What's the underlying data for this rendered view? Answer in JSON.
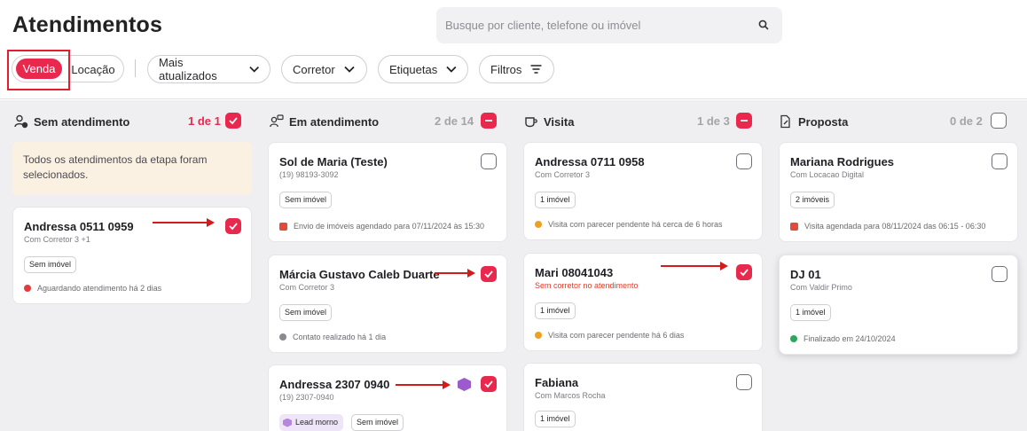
{
  "page_title": "Atendimentos",
  "search": {
    "placeholder": "Busque por cliente, telefone ou imóvel"
  },
  "segment": {
    "venda": "Venda",
    "locacao": "Locação"
  },
  "filters": {
    "sort": "Mais atualizados",
    "agent": "Corretor",
    "tags": "Etiquetas",
    "filters": "Filtros"
  },
  "columns": [
    {
      "title": "Sem atendimento",
      "count": "1 de 1",
      "notice": "Todos os atendimentos da etapa foram selecionados.",
      "cards": [
        {
          "name": "Andressa 0511 0959",
          "sub": "Com Corretor 3 +1",
          "tag": "Sem imóvel",
          "status": "Aguardando atendimento há 2 dias"
        }
      ]
    },
    {
      "title": "Em atendimento",
      "count": "2 de 14",
      "cards": [
        {
          "name": "Sol de Maria (Teste)",
          "sub": "(19) 98193-3092",
          "tag": "Sem imóvel",
          "status": "Envio de imóveis agendado para 07/11/2024 às 15:30"
        },
        {
          "name": "Márcia Gustavo Caleb Duarte",
          "sub": "Com Corretor 3",
          "tag": "Sem imóvel",
          "status": "Contato realizado há 1 dia"
        },
        {
          "name": "Andressa 2307 0940",
          "sub": "(19) 2307-0940",
          "lead_tag": "Lead morno",
          "tag": "Sem imóvel"
        }
      ]
    },
    {
      "title": "Visita",
      "count": "1 de 3",
      "cards": [
        {
          "name": "Andressa 0711 0958",
          "sub": "Com Corretor 3",
          "tag": "1 imóvel",
          "status": "Visita com parecer pendente há cerca de 6 horas"
        },
        {
          "name": "Mari 08041043",
          "sub": "Sem corretor no atendimento",
          "tag": "1 imóvel",
          "status": "Visita com parecer pendente há 6 dias"
        },
        {
          "name": "Fabiana",
          "sub": "Com Marcos Rocha",
          "tag": "1 imóvel"
        }
      ]
    },
    {
      "title": "Proposta",
      "count": "0 de 2",
      "cards": [
        {
          "name": "Mariana Rodrigues",
          "sub": "Com Locacao Digital",
          "tag": "2 imóveis",
          "status": "Visita agendada para 08/11/2024 das 06:15 - 06:30"
        },
        {
          "name": "DJ 01",
          "sub": "Com Valdir Primo",
          "tag": "1 imóvel",
          "status": "Finalizado em 24/10/2024"
        }
      ]
    }
  ],
  "colors": {
    "accent": "#e8294d",
    "annotation": "#d41b1b"
  }
}
